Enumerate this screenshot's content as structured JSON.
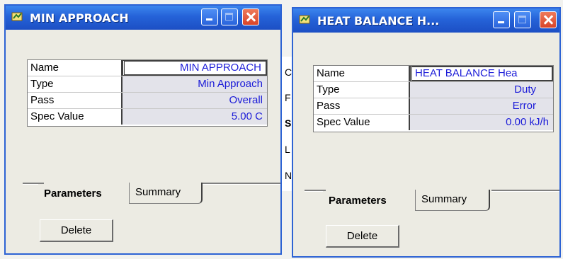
{
  "background_fragments": [
    "C",
    "F",
    "S",
    "L",
    "N"
  ],
  "windows": [
    {
      "title": "MIN APPROACH",
      "rows": [
        {
          "label": "Name",
          "value": "MIN APPROACH"
        },
        {
          "label": "Type",
          "value": "Min Approach"
        },
        {
          "label": "Pass",
          "value": "Overall"
        },
        {
          "label": "Spec Value",
          "value": "5.00 C"
        }
      ],
      "tabs": {
        "active": "Parameters",
        "inactive": "Summary"
      },
      "delete_label": "Delete"
    },
    {
      "title": "HEAT BALANCE H...",
      "rows": [
        {
          "label": "Name",
          "value": "HEAT BALANCE Hea"
        },
        {
          "label": "Type",
          "value": "Duty"
        },
        {
          "label": "Pass",
          "value": "Error"
        },
        {
          "label": "Spec Value",
          "value": "0.00 kJ/h"
        }
      ],
      "tabs": {
        "active": "Parameters",
        "inactive": "Summary"
      },
      "delete_label": "Delete"
    }
  ],
  "colors": {
    "title_bar": "#2562d8",
    "value_text": "#1b1bd8",
    "close_button": "#d8442a"
  }
}
